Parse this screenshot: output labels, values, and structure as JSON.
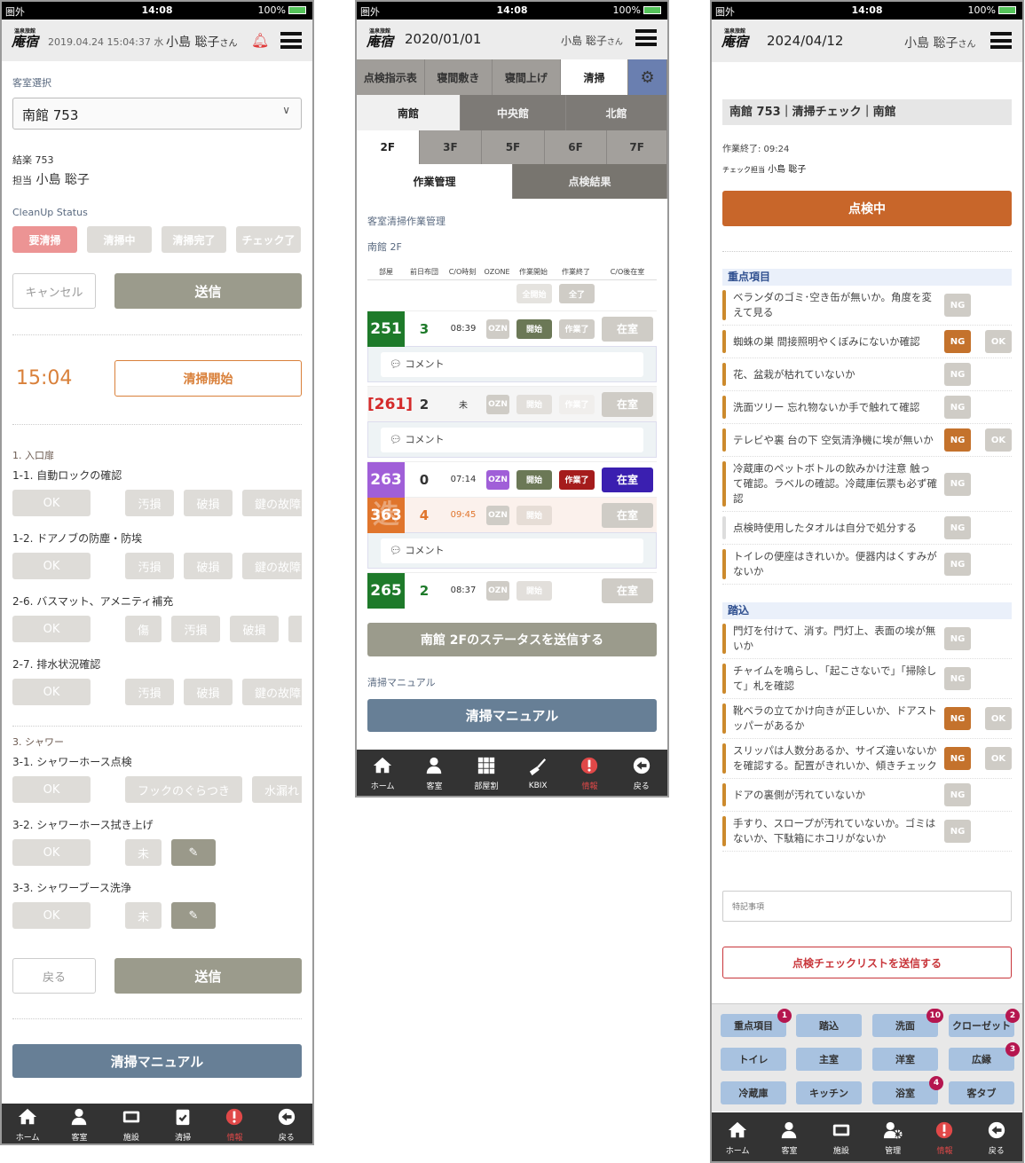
{
  "status_bar": {
    "carrier": "圏外",
    "time": "14:08",
    "battery": "100%"
  },
  "logo": {
    "small": "温泉旅館",
    "large": "庵宿"
  },
  "screen1": {
    "header": {
      "datetime": "2019.04.24 15:04:37 水",
      "user": "小島 聡子",
      "honorific": "さん"
    },
    "room_select_label": "客室選択",
    "room_select_value": "南館 753",
    "room_info": "結楽 753",
    "assignee_label": "担当",
    "assignee": "小島 聡子",
    "status_label": "CleanUp Status",
    "statuses": [
      {
        "label": "要清掃",
        "active": true
      },
      {
        "label": "清掃中",
        "active": false
      },
      {
        "label": "清掃完了",
        "active": false
      },
      {
        "label": "チェック了",
        "active": false
      }
    ],
    "cancel": "キャンセル",
    "send": "送信",
    "time": "15:04",
    "start": "清掃開始",
    "sections": [
      {
        "title": "1. 入口扉",
        "items": [
          {
            "label": "1-1. 自動ロックの確認",
            "options": [
              "OK",
              "汚損",
              "破損",
              "鍵の故障"
            ]
          },
          {
            "label": "1-2. ドアノブの防塵・防埃",
            "options": [
              "OK",
              "汚損",
              "破損",
              "鍵の故障"
            ]
          },
          {
            "label": "2-6. バスマット、アメニティ補充",
            "options": [
              "OK",
              "傷",
              "汚損",
              "破損",
              ""
            ]
          },
          {
            "label": "2-7. 排水状況確認",
            "options": [
              "OK",
              "汚損",
              "破損",
              "鍵の故障"
            ]
          }
        ]
      },
      {
        "title": "3. シャワー",
        "items": [
          {
            "label": "3-1. シャワーホース点検",
            "options": [
              "OK",
              "フックのぐらつき",
              "水漏れ"
            ]
          },
          {
            "label": "3-2. シャワーホース拭き上げ",
            "options": [
              "OK",
              "未"
            ],
            "edit": true
          },
          {
            "label": "3-3. シャワーブース洗浄",
            "options": [
              "OK",
              "未"
            ],
            "edit": true
          }
        ]
      }
    ],
    "back": "戻る",
    "send2": "送信",
    "manual": "清掃マニュアル",
    "nav": [
      {
        "label": "ホーム",
        "icon": "home"
      },
      {
        "label": "客室",
        "icon": "person"
      },
      {
        "label": "施設",
        "icon": "facility"
      },
      {
        "label": "清掃",
        "icon": "clipboard"
      },
      {
        "label": "情報",
        "icon": "alert",
        "active": true
      },
      {
        "label": "戻る",
        "icon": "back"
      }
    ]
  },
  "screen2": {
    "header": {
      "date": "2020/01/01",
      "user": "小島 聡子",
      "honorific": "さん"
    },
    "tabs": [
      {
        "label": "点検指示表"
      },
      {
        "label": "寝間敷き"
      },
      {
        "label": "寝間上げ"
      },
      {
        "label": "清掃",
        "active": true
      }
    ],
    "buildings": [
      {
        "label": "南館",
        "active": true
      },
      {
        "label": "中央館"
      },
      {
        "label": "北館"
      }
    ],
    "floors": [
      {
        "label": "2F",
        "active": true
      },
      {
        "label": "3F"
      },
      {
        "label": "5F"
      },
      {
        "label": "6F"
      },
      {
        "label": "7F"
      }
    ],
    "subtabs": [
      {
        "label": "作業管理",
        "active": true
      },
      {
        "label": "点検結果"
      }
    ],
    "section_title": "客室清掃作業管理",
    "location": "南館 2F",
    "columns": [
      "部屋",
      "前日布団",
      "C/O時刻",
      "OZONE",
      "作業開始",
      "作業終了",
      "C/O後在室"
    ],
    "bulk": {
      "start_all": "全開始",
      "end_all": "全了"
    },
    "rooms": [
      {
        "room": "251",
        "bg": "#1e7a2a",
        "futon": "3",
        "futon_color": "#1e7a2a",
        "co": "08:39",
        "co_color": "#333",
        "ozn": "OZN",
        "ozn_bg": "#cfccc6",
        "start": "開始",
        "start_bg": "#6b7856",
        "end": "作業了",
        "end_bg": "#cfccc6",
        "stay": "在室",
        "stay_bg": "#cfccc6",
        "row_bg": "#fff",
        "comment": "コメント"
      },
      {
        "room": "[261]",
        "bg": "",
        "room_color": "#d42a2a",
        "futon": "2",
        "futon_color": "#333",
        "co": "未",
        "co_color": "#333",
        "ozn": "OZN",
        "ozn_bg": "#cfccc6",
        "start": "開始",
        "start_bg": "#e2dfdb",
        "end": "作業了",
        "end_bg": "#f0eeec",
        "stay": "在室",
        "stay_bg": "#cfccc6",
        "row_bg": "#f5f5f5",
        "comment": "コメント"
      },
      {
        "room": "263",
        "bg": "#a05fd8",
        "futon": "0",
        "futon_color": "#333",
        "co": "07:14",
        "co_color": "#333",
        "ozn": "OZN",
        "ozn_bg": "#a05fd8",
        "start": "開始",
        "start_bg": "#6b7856",
        "end": "作業了",
        "end_bg": "#a51c1c",
        "stay": "在室",
        "stay_bg": "#3a1fb0",
        "row_bg": "#fff"
      },
      {
        "room": "363",
        "bg": "#e0752c",
        "mark": "迭",
        "futon": "4",
        "futon_color": "#e0752c",
        "co": "09:45",
        "co_color": "#e0752c",
        "ozn": "OZN",
        "ozn_bg": "#cfccc6",
        "start": "開始",
        "start_bg": "#e6ddd6",
        "end": "",
        "end_bg": "transparent",
        "stay": "在室",
        "stay_bg": "#cfccc6",
        "row_bg": "#fbf1ec",
        "comment": "コメント"
      },
      {
        "room": "265",
        "bg": "#1e7a2a",
        "futon": "2",
        "futon_color": "#1e7a2a",
        "co": "08:37",
        "co_color": "#333",
        "ozn": "OZN",
        "ozn_bg": "#cfccc6",
        "start": "開始",
        "start_bg": "#e2dfdb",
        "end": "",
        "end_bg": "transparent",
        "stay": "在室",
        "stay_bg": "#cfccc6",
        "row_bg": "#fff"
      }
    ],
    "send_status": "南館 2Fのステータスを送信する",
    "manual_label": "清掃マニュアル",
    "manual": "清掃マニュアル",
    "nav": [
      {
        "label": "ホーム",
        "icon": "home"
      },
      {
        "label": "客室",
        "icon": "person"
      },
      {
        "label": "部屋割",
        "icon": "grid"
      },
      {
        "label": "KBIX",
        "icon": "broom"
      },
      {
        "label": "情報",
        "icon": "alert",
        "active": true
      },
      {
        "label": "戻る",
        "icon": "back"
      }
    ]
  },
  "screen3": {
    "header": {
      "date": "2024/04/12",
      "user": "小島 聡子",
      "honorific": "さん"
    },
    "title": "南館 753｜清掃チェック｜南館",
    "work_end": "作業終了: 09:24",
    "checker_label": "チェック担当",
    "checker": "小島 聡子",
    "status_button": "点検中",
    "sections": [
      {
        "title": "重点項目",
        "items": [
          {
            "text": "ベランダのゴミ･空き缶が無いか。角度を変えて見る",
            "ng": false
          },
          {
            "text": "蜘蛛の巣 間接照明やくぼみにないか確認",
            "ng": true
          },
          {
            "text": "花、盆栽が枯れていないか",
            "ng": false
          },
          {
            "text": "洗面ツリー 忘れ物ないか手で触れて確認",
            "ng": false
          },
          {
            "text": "テレビや裏 台の下 空気清浄機に埃が無いか",
            "ng": true
          },
          {
            "text": "冷蔵庫のペットボトルの飲みかけ注意 触って確認。ラベルの確認。冷蔵庫伝票も必ず確認",
            "ng": false
          },
          {
            "text": "点検時使用したタオルは自分で処分する",
            "ng": false,
            "muted": true
          },
          {
            "text": "トイレの便座はきれいか。便器内はくすみがないか",
            "ng": false
          }
        ]
      },
      {
        "title": "踏込",
        "items": [
          {
            "text": "門灯を付けて、消す。門灯上、表面の埃が無いか",
            "ng": false
          },
          {
            "text": "チャイムを鳴らし、「起こさないで」「掃除して」札を確認",
            "ng": false
          },
          {
            "text": "靴ベラの立てかけ向きが正しいか、ドアストッパーがあるか",
            "ng": true
          },
          {
            "text": "スリッパは人数分あるか、サイズ違いないかを確認する。配置がきれいか、傾きチェック",
            "ng": true
          },
          {
            "text": "ドアの裏側が汚れていないか",
            "ng": false
          },
          {
            "text": "手すり、スロープが汚れていないか。ゴミはないか、下駄箱にホコリがないか",
            "ng": false
          }
        ]
      }
    ],
    "ng_label": "NG",
    "ok_label": "OK",
    "notes_placeholder": "特記事項",
    "submit": "点検チェックリストを送信する",
    "categories": [
      {
        "label": "重点項目",
        "badge": "1"
      },
      {
        "label": "踏込"
      },
      {
        "label": "洗面",
        "badge": "10"
      },
      {
        "label": "クローゼット",
        "badge": "2"
      },
      {
        "label": "トイレ"
      },
      {
        "label": "主室"
      },
      {
        "label": "洋室"
      },
      {
        "label": "広縁",
        "badge": "3"
      },
      {
        "label": "冷蔵庫"
      },
      {
        "label": "キッチン"
      },
      {
        "label": "浴室",
        "badge": "4"
      },
      {
        "label": "客タブ"
      }
    ],
    "nav": [
      {
        "label": "ホーム",
        "icon": "home"
      },
      {
        "label": "客室",
        "icon": "person"
      },
      {
        "label": "施設",
        "icon": "facility"
      },
      {
        "label": "管理",
        "icon": "manage"
      },
      {
        "label": "情報",
        "icon": "alert",
        "active": true
      },
      {
        "label": "戻る",
        "icon": "back"
      }
    ]
  },
  "colors": {
    "accent_orange": "#c8662a",
    "manual_blue": "#677f96",
    "olive": "#9b9b8c",
    "alert_red": "#e04848",
    "category_blue": "#a8c2e0",
    "badge": "#b5164f"
  }
}
